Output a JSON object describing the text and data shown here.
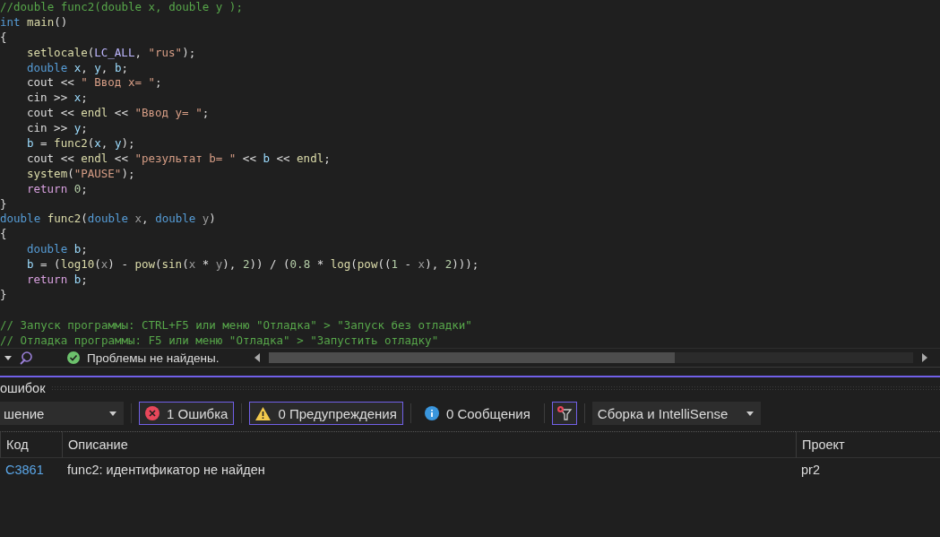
{
  "editor": {
    "lines": [
      {
        "kind": "code",
        "indent": false,
        "tokens": [
          {
            "kind": "comment",
            "text": "//double func2(double x, double y );"
          }
        ]
      },
      {
        "kind": "code",
        "indent": false,
        "tokens": [
          {
            "kind": "kw",
            "text": "int "
          },
          {
            "kind": "fn",
            "text": "main"
          },
          {
            "kind": "plain",
            "text": "()"
          }
        ]
      },
      {
        "kind": "code",
        "indent": false,
        "tokens": [
          {
            "kind": "plain",
            "text": "{"
          }
        ]
      },
      {
        "kind": "code",
        "indent": true,
        "tokens": [
          {
            "kind": "fn",
            "text": "setlocale"
          },
          {
            "kind": "plain",
            "text": "("
          },
          {
            "kind": "macro",
            "text": "LC_ALL"
          },
          {
            "kind": "plain",
            "text": ", "
          },
          {
            "kind": "str",
            "text": "\"rus\""
          },
          {
            "kind": "plain",
            "text": ");"
          }
        ]
      },
      {
        "kind": "code",
        "indent": true,
        "tokens": [
          {
            "kind": "kw",
            "text": "double "
          },
          {
            "kind": "var",
            "text": "x"
          },
          {
            "kind": "plain",
            "text": ", "
          },
          {
            "kind": "var",
            "text": "y"
          },
          {
            "kind": "plain",
            "text": ", "
          },
          {
            "kind": "var",
            "text": "b"
          },
          {
            "kind": "plain",
            "text": ";"
          }
        ]
      },
      {
        "kind": "code",
        "indent": true,
        "tokens": [
          {
            "kind": "plain",
            "text": "cout << "
          },
          {
            "kind": "str",
            "text": "\" Ввод x= \""
          },
          {
            "kind": "plain",
            "text": ";"
          }
        ]
      },
      {
        "kind": "code",
        "indent": true,
        "tokens": [
          {
            "kind": "plain",
            "text": "cin >> "
          },
          {
            "kind": "var",
            "text": "x"
          },
          {
            "kind": "plain",
            "text": ";"
          }
        ]
      },
      {
        "kind": "code",
        "indent": true,
        "tokens": [
          {
            "kind": "plain",
            "text": "cout << "
          },
          {
            "kind": "fn",
            "text": "endl"
          },
          {
            "kind": "plain",
            "text": " << "
          },
          {
            "kind": "str",
            "text": "\"Ввод y= \""
          },
          {
            "kind": "plain",
            "text": ";"
          }
        ]
      },
      {
        "kind": "code",
        "indent": true,
        "tokens": [
          {
            "kind": "plain",
            "text": "cin >> "
          },
          {
            "kind": "var",
            "text": "y"
          },
          {
            "kind": "plain",
            "text": ";"
          }
        ]
      },
      {
        "kind": "code",
        "indent": true,
        "tokens": [
          {
            "kind": "var",
            "text": "b"
          },
          {
            "kind": "plain",
            "text": " = "
          },
          {
            "kind": "fn",
            "text": "func2"
          },
          {
            "kind": "plain",
            "text": "("
          },
          {
            "kind": "var",
            "text": "x"
          },
          {
            "kind": "plain",
            "text": ", "
          },
          {
            "kind": "var",
            "text": "y"
          },
          {
            "kind": "plain",
            "text": ");"
          }
        ]
      },
      {
        "kind": "code",
        "indent": true,
        "tokens": [
          {
            "kind": "plain",
            "text": "cout << "
          },
          {
            "kind": "fn",
            "text": "endl"
          },
          {
            "kind": "plain",
            "text": " << "
          },
          {
            "kind": "str",
            "text": "\"результат b= \""
          },
          {
            "kind": "plain",
            "text": " << "
          },
          {
            "kind": "var",
            "text": "b"
          },
          {
            "kind": "plain",
            "text": " << "
          },
          {
            "kind": "fn",
            "text": "endl"
          },
          {
            "kind": "plain",
            "text": ";"
          }
        ]
      },
      {
        "kind": "code",
        "indent": true,
        "tokens": [
          {
            "kind": "fn",
            "text": "system"
          },
          {
            "kind": "plain",
            "text": "("
          },
          {
            "kind": "str",
            "text": "\"PAUSE\""
          },
          {
            "kind": "plain",
            "text": ");"
          }
        ]
      },
      {
        "kind": "code",
        "indent": true,
        "tokens": [
          {
            "kind": "ctrl",
            "text": "return "
          },
          {
            "kind": "num",
            "text": "0"
          },
          {
            "kind": "plain",
            "text": ";"
          }
        ]
      },
      {
        "kind": "code",
        "indent": false,
        "tokens": [
          {
            "kind": "plain",
            "text": "}"
          }
        ]
      },
      {
        "kind": "code",
        "indent": false,
        "tokens": [
          {
            "kind": "kw",
            "text": "double "
          },
          {
            "kind": "fn",
            "text": "func2"
          },
          {
            "kind": "plain",
            "text": "("
          },
          {
            "kind": "kw",
            "text": "double "
          },
          {
            "kind": "param",
            "text": "x"
          },
          {
            "kind": "plain",
            "text": ", "
          },
          {
            "kind": "kw",
            "text": "double "
          },
          {
            "kind": "param",
            "text": "y"
          },
          {
            "kind": "plain",
            "text": ")"
          }
        ]
      },
      {
        "kind": "code",
        "indent": false,
        "tokens": [
          {
            "kind": "plain",
            "text": "{"
          }
        ]
      },
      {
        "kind": "code",
        "indent": true,
        "tokens": [
          {
            "kind": "kw",
            "text": "double "
          },
          {
            "kind": "var",
            "text": "b"
          },
          {
            "kind": "plain",
            "text": ";"
          }
        ]
      },
      {
        "kind": "code",
        "indent": true,
        "tokens": [
          {
            "kind": "var",
            "text": "b"
          },
          {
            "kind": "plain",
            "text": " = ("
          },
          {
            "kind": "fn",
            "text": "log10"
          },
          {
            "kind": "plain",
            "text": "("
          },
          {
            "kind": "param",
            "text": "x"
          },
          {
            "kind": "plain",
            "text": ") - "
          },
          {
            "kind": "fn",
            "text": "pow"
          },
          {
            "kind": "plain",
            "text": "("
          },
          {
            "kind": "fn",
            "text": "sin"
          },
          {
            "kind": "plain",
            "text": "("
          },
          {
            "kind": "param",
            "text": "x"
          },
          {
            "kind": "plain",
            "text": " * "
          },
          {
            "kind": "param",
            "text": "y"
          },
          {
            "kind": "plain",
            "text": "), "
          },
          {
            "kind": "num",
            "text": "2"
          },
          {
            "kind": "plain",
            "text": ")) / ("
          },
          {
            "kind": "num",
            "text": "0.8"
          },
          {
            "kind": "plain",
            "text": " * "
          },
          {
            "kind": "fn",
            "text": "log"
          },
          {
            "kind": "plain",
            "text": "("
          },
          {
            "kind": "fn",
            "text": "pow"
          },
          {
            "kind": "plain",
            "text": "(("
          },
          {
            "kind": "num",
            "text": "1"
          },
          {
            "kind": "plain",
            "text": " - "
          },
          {
            "kind": "param",
            "text": "x"
          },
          {
            "kind": "plain",
            "text": "), "
          },
          {
            "kind": "num",
            "text": "2"
          },
          {
            "kind": "plain",
            "text": ")));"
          }
        ]
      },
      {
        "kind": "code",
        "indent": true,
        "tokens": [
          {
            "kind": "ctrl",
            "text": "return "
          },
          {
            "kind": "var",
            "text": "b"
          },
          {
            "kind": "plain",
            "text": ";"
          }
        ]
      },
      {
        "kind": "code",
        "indent": false,
        "tokens": [
          {
            "kind": "plain",
            "text": "}"
          }
        ]
      },
      {
        "kind": "blank"
      },
      {
        "kind": "code",
        "indent": false,
        "tokens": [
          {
            "kind": "comment",
            "text": "// Запуск программы: CTRL+F5 или меню \"Отладка\" > \"Запуск без отладки\""
          }
        ]
      },
      {
        "kind": "code",
        "indent": false,
        "tokens": [
          {
            "kind": "comment",
            "text": "// Отладка программы: F5 или меню \"Отладка\" > \"Запустить отладку\""
          }
        ]
      }
    ]
  },
  "status_bar": {
    "message": "Проблемы не найдены."
  },
  "error_list": {
    "title": "ошибок",
    "scope_dropdown": "шение",
    "filters": [
      {
        "kind": "error",
        "label": "1 Ошибка",
        "selected": true
      },
      {
        "kind": "warning",
        "label": "0 Предупреждения",
        "selected": true
      },
      {
        "kind": "info",
        "label": "0 Сообщения",
        "selected": false
      }
    ],
    "source_dropdown": "Сборка и IntelliSense",
    "columns": [
      "Код",
      "Описание",
      "Проект"
    ],
    "rows": [
      {
        "code": "C3861",
        "description": "func2: идентификатор не найден",
        "project": "pr2"
      }
    ]
  }
}
